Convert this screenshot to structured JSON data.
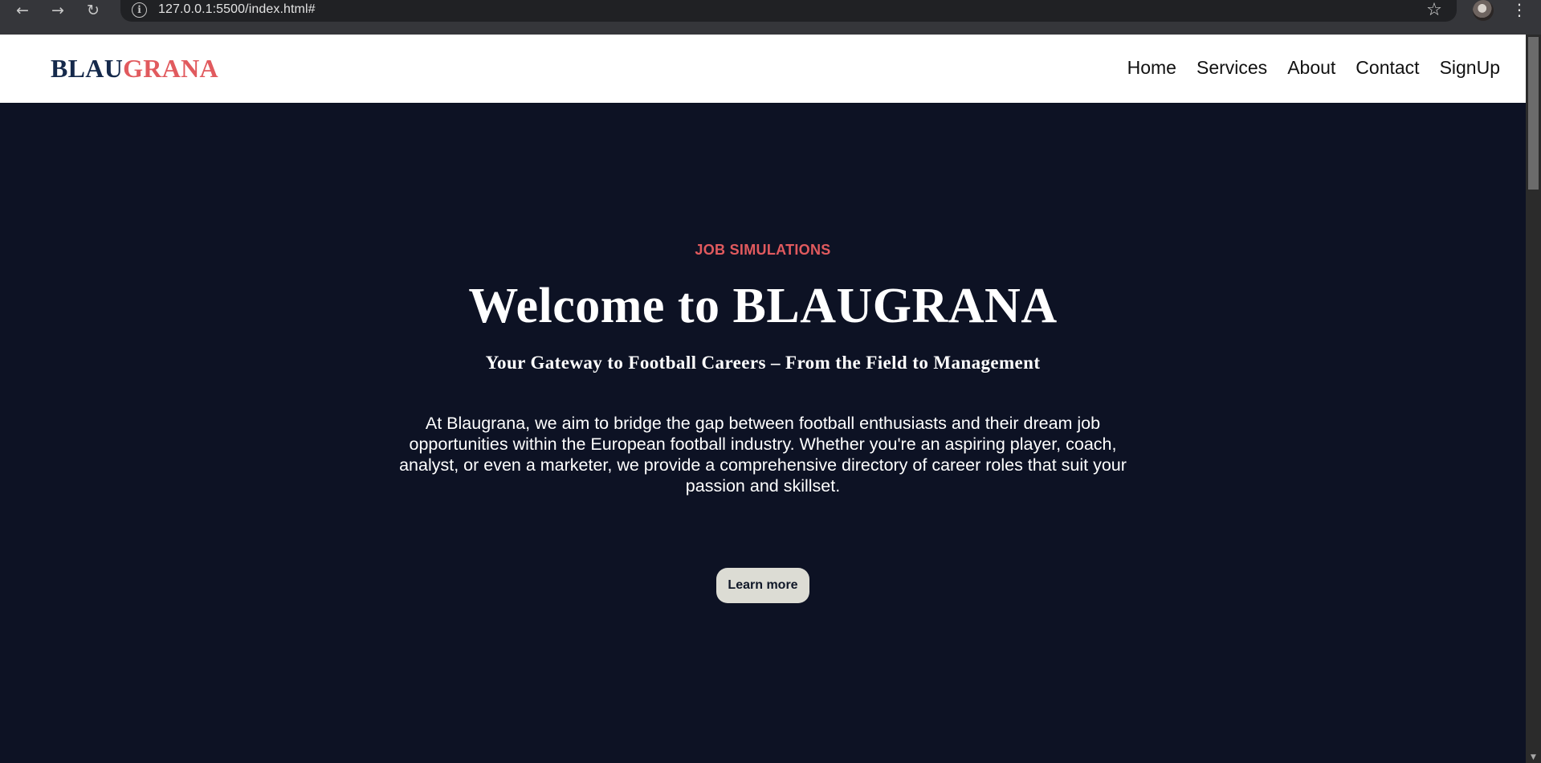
{
  "browser": {
    "back_icon": "←",
    "forward_icon": "→",
    "reload_icon": "↻",
    "info_icon": "i",
    "url": "127.0.0.1:5500/index.html#",
    "star_icon": "☆",
    "menu_icon": "⋮"
  },
  "header": {
    "logo_part1": "BLAU",
    "logo_part2": "GRANA",
    "nav": {
      "home": "Home",
      "services": "Services",
      "about": "About",
      "contact": "Contact",
      "signup": "SignUp"
    }
  },
  "hero": {
    "eyebrow": "JOB SIMULATIONS",
    "title": "Welcome to BLAUGRANA",
    "subtitle": "Your Gateway to Football Careers – From the Field to Management",
    "description": "At Blaugrana, we aim to bridge the gap between football enthusiasts and their dream job opportunities within the European football industry. Whether you're an aspiring player, coach, analyst, or even a marketer, we provide a comprehensive directory of career roles that suit your passion and skillset.",
    "button": "Learn more"
  },
  "colors": {
    "brand_navy": "#15294b",
    "brand_red": "#e15a5e",
    "hero_bg": "#0d1224",
    "button_bg": "#dcdcd4"
  },
  "scrollbar": {
    "up_icon": "▲",
    "down_icon": "▼"
  }
}
